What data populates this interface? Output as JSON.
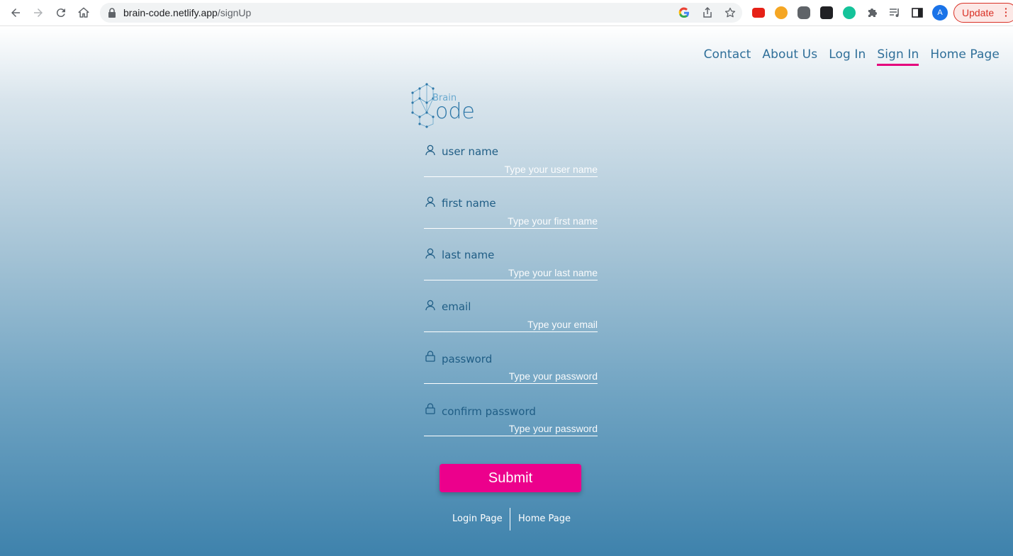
{
  "browser": {
    "url_domain": "brain-code.netlify.app",
    "url_path": "/signUp",
    "avatar_letter": "A",
    "update_label": "Update"
  },
  "nav": {
    "links": [
      {
        "label": "Contact"
      },
      {
        "label": "About Us"
      },
      {
        "label": "Log In"
      },
      {
        "label": "Sign In"
      },
      {
        "label": "Home Page"
      }
    ],
    "active": "Sign In",
    "active_color": "#e4007c"
  },
  "logo": {
    "text_small": "Brain",
    "text_large": "ode"
  },
  "form": {
    "fields": [
      {
        "label": "user name",
        "placeholder": "Type your user name",
        "icon": "user-icon"
      },
      {
        "label": "first name",
        "placeholder": "Type your first name",
        "icon": "user-icon"
      },
      {
        "label": "last name",
        "placeholder": "Type your last name",
        "icon": "user-icon"
      },
      {
        "label": "email",
        "placeholder": "Type your email",
        "icon": "user-icon"
      },
      {
        "label": "password",
        "placeholder": "Type your password",
        "icon": "lock-icon"
      },
      {
        "label": "confirm password",
        "placeholder": "Type your password",
        "icon": "lock-icon"
      }
    ],
    "submit_label": "Submit",
    "submit_color": "#ec008c"
  },
  "footer_links": {
    "login": "Login Page",
    "home": "Home Page"
  }
}
